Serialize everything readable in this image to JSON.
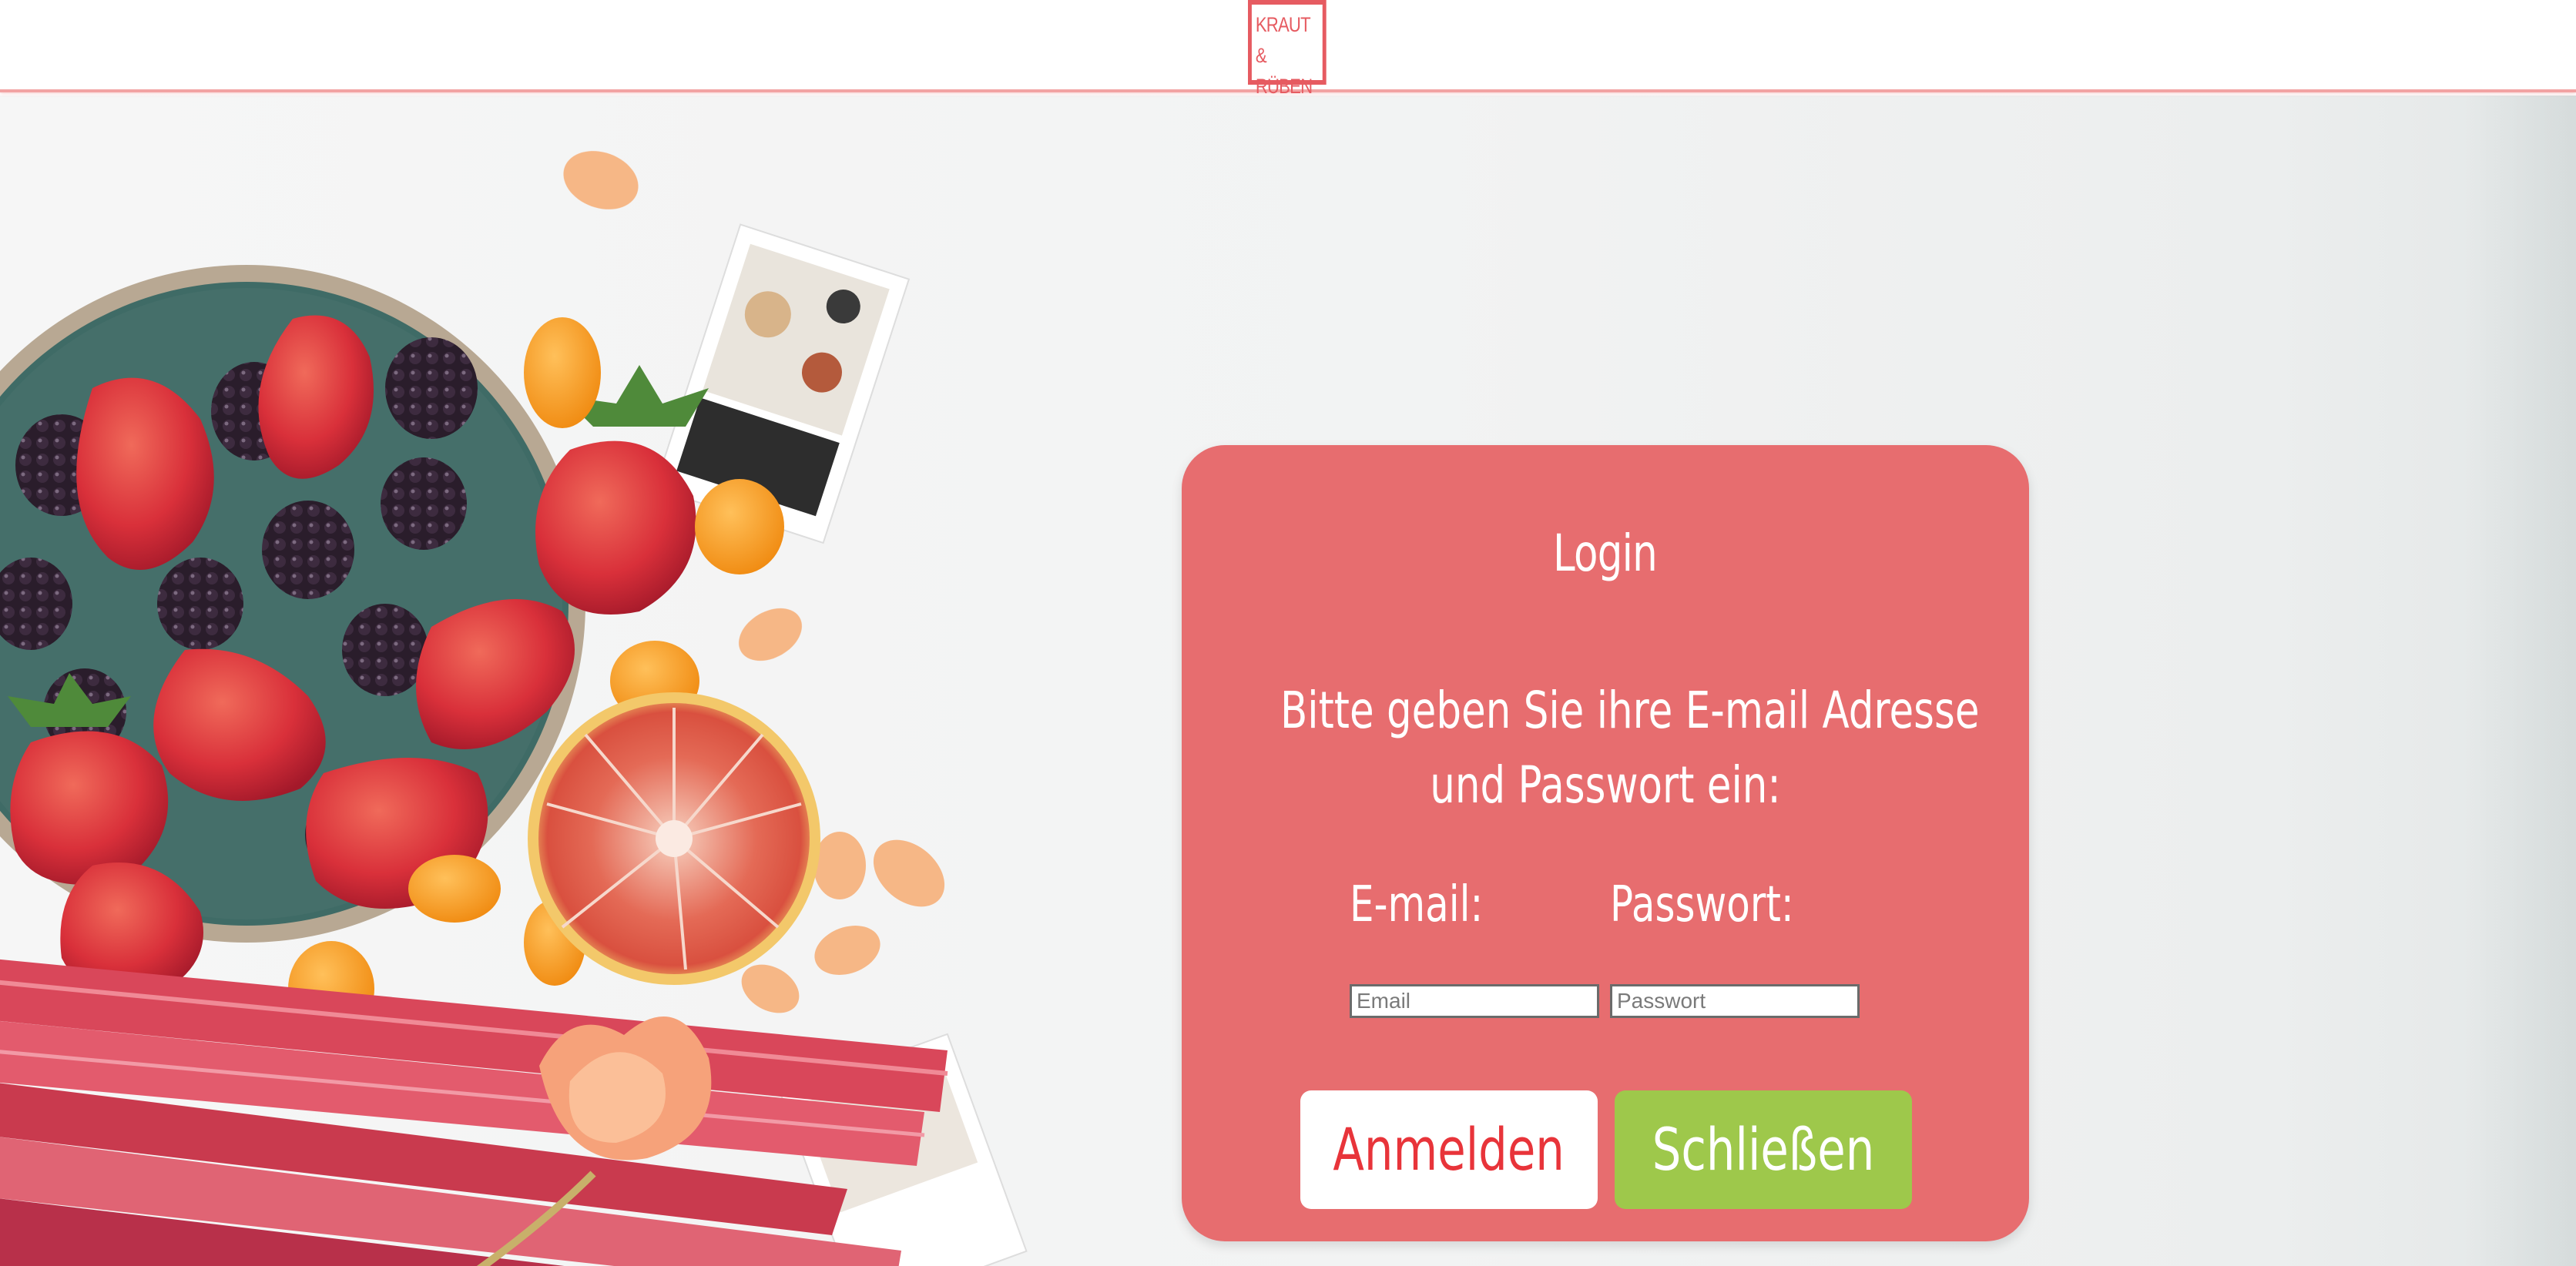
{
  "header": {
    "logo_line1": "KRAUT &",
    "logo_line2": "RÜBEN"
  },
  "login_card": {
    "title": "Login",
    "instruction_line1": "Bitte geben Sie ihre E-mail Adresse",
    "instruction_line2": "und Passwort ein:",
    "email_label": "E-mail:",
    "password_label": "Passwort:",
    "email_placeholder": "Email",
    "password_placeholder": "Passwort",
    "login_button": "Anmelden",
    "close_button": "Schließen"
  },
  "colors": {
    "accent_red": "#e65b61",
    "card_background": "#e76d6f",
    "close_button_green": "#9ec84b",
    "login_button_text": "#e8343a"
  }
}
